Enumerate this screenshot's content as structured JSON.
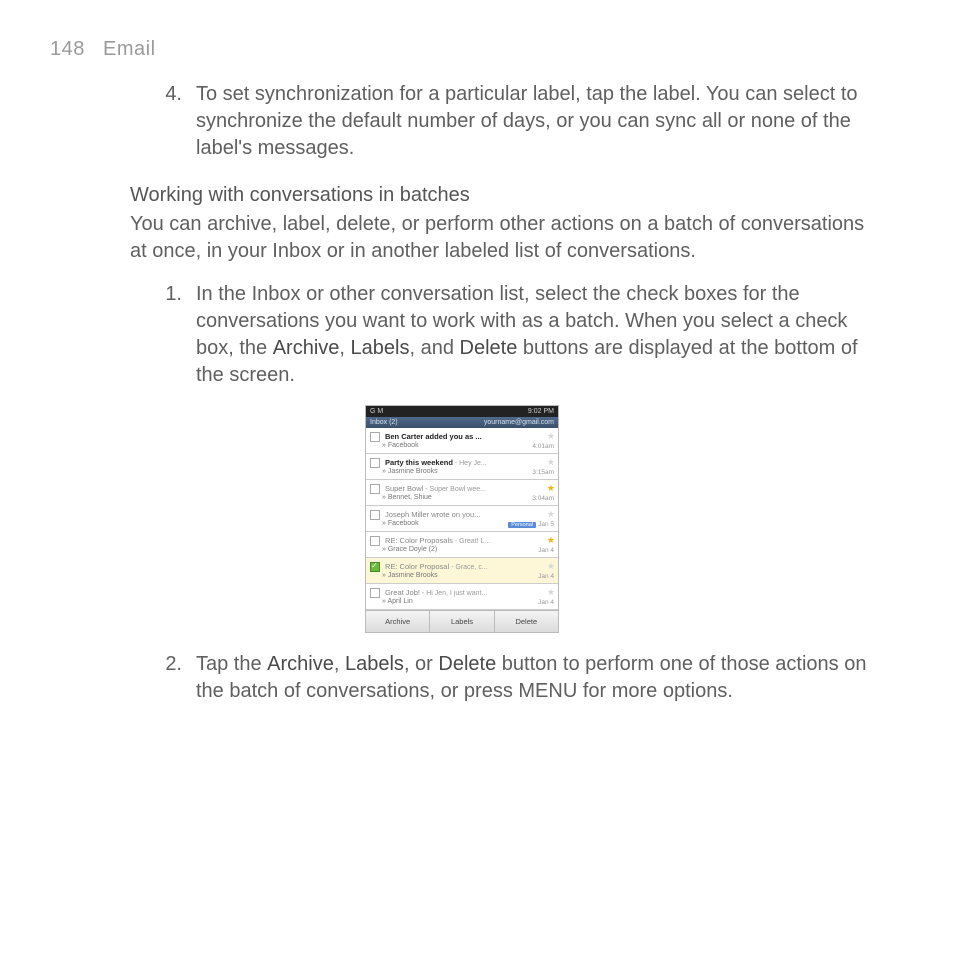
{
  "page_header": {
    "page_number": "148",
    "section": "Email"
  },
  "step4": {
    "num": "4.",
    "text": "To set synchronization for a particular label, tap the label. You can select to synchronize the default number of days, or you can sync all or none of the label's messages."
  },
  "batches": {
    "heading": "Working with conversations in batches",
    "intro": "You can archive, label, delete, or perform other actions on a batch of conversations at once, in your Inbox or in another labeled list of conversations."
  },
  "step1": {
    "num": "1.",
    "pre": "In the Inbox or other conversation list, select the check boxes for the conversations you want to work with as a batch. When you select a check box, the ",
    "archive": "Archive",
    "sep1": ", ",
    "labels": "Labels",
    "sep2": ", and ",
    "delete": "Delete",
    "post": " buttons are displayed at the bottom of the screen."
  },
  "step2": {
    "num": "2.",
    "pre": "Tap the ",
    "archive": "Archive",
    "sep1": ", ",
    "labels": "Labels",
    "sep2": ", or ",
    "delete": "Delete",
    "post": " button to perform one of those actions on the batch of conversations, or press MENU for more options."
  },
  "phone": {
    "status_left": "G M",
    "status_right": "9:02 PM",
    "title_left": "Inbox (2)",
    "title_right": "yourname@gmail.com",
    "rows": [
      {
        "subj": "Ben Carter added you as ...",
        "from": "» Facebook",
        "time": "4:01am",
        "star": false,
        "read": false,
        "sel": false
      },
      {
        "subj": "Party this weekend",
        "prev": " - Hey Je...",
        "from": "» Jasmine Brooks",
        "time": "3:15am",
        "star": false,
        "read": false,
        "sel": false
      },
      {
        "subj": "Super Bowl",
        "prev": " - Super Bowl wee...",
        "from": "» Bennet, Shiue",
        "time": "3:04am",
        "star": true,
        "read": true,
        "sel": false
      },
      {
        "subj": "Joseph Miller wrote on you...",
        "from": "» Facebook",
        "time": "Jan 5",
        "star": false,
        "read": true,
        "sel": false,
        "badge": "Personal"
      },
      {
        "subj": "RE: Color Proposals",
        "prev": " - Great! L...",
        "from": "» Grace Doyle (2)",
        "time": "Jan 4",
        "star": true,
        "read": true,
        "sel": false
      },
      {
        "subj": "RE: Color Proposal",
        "prev": " - Grace, c...",
        "from": "» Jasmine Brooks",
        "time": "Jan 4",
        "star": false,
        "read": true,
        "sel": true
      },
      {
        "subj": "Great Job!",
        "prev": " - Hi Jen, I just want...",
        "from": "» April Lin",
        "time": "Jan 4",
        "star": false,
        "read": true,
        "sel": false
      }
    ],
    "actions": {
      "archive": "Archive",
      "labels": "Labels",
      "delete": "Delete"
    }
  }
}
